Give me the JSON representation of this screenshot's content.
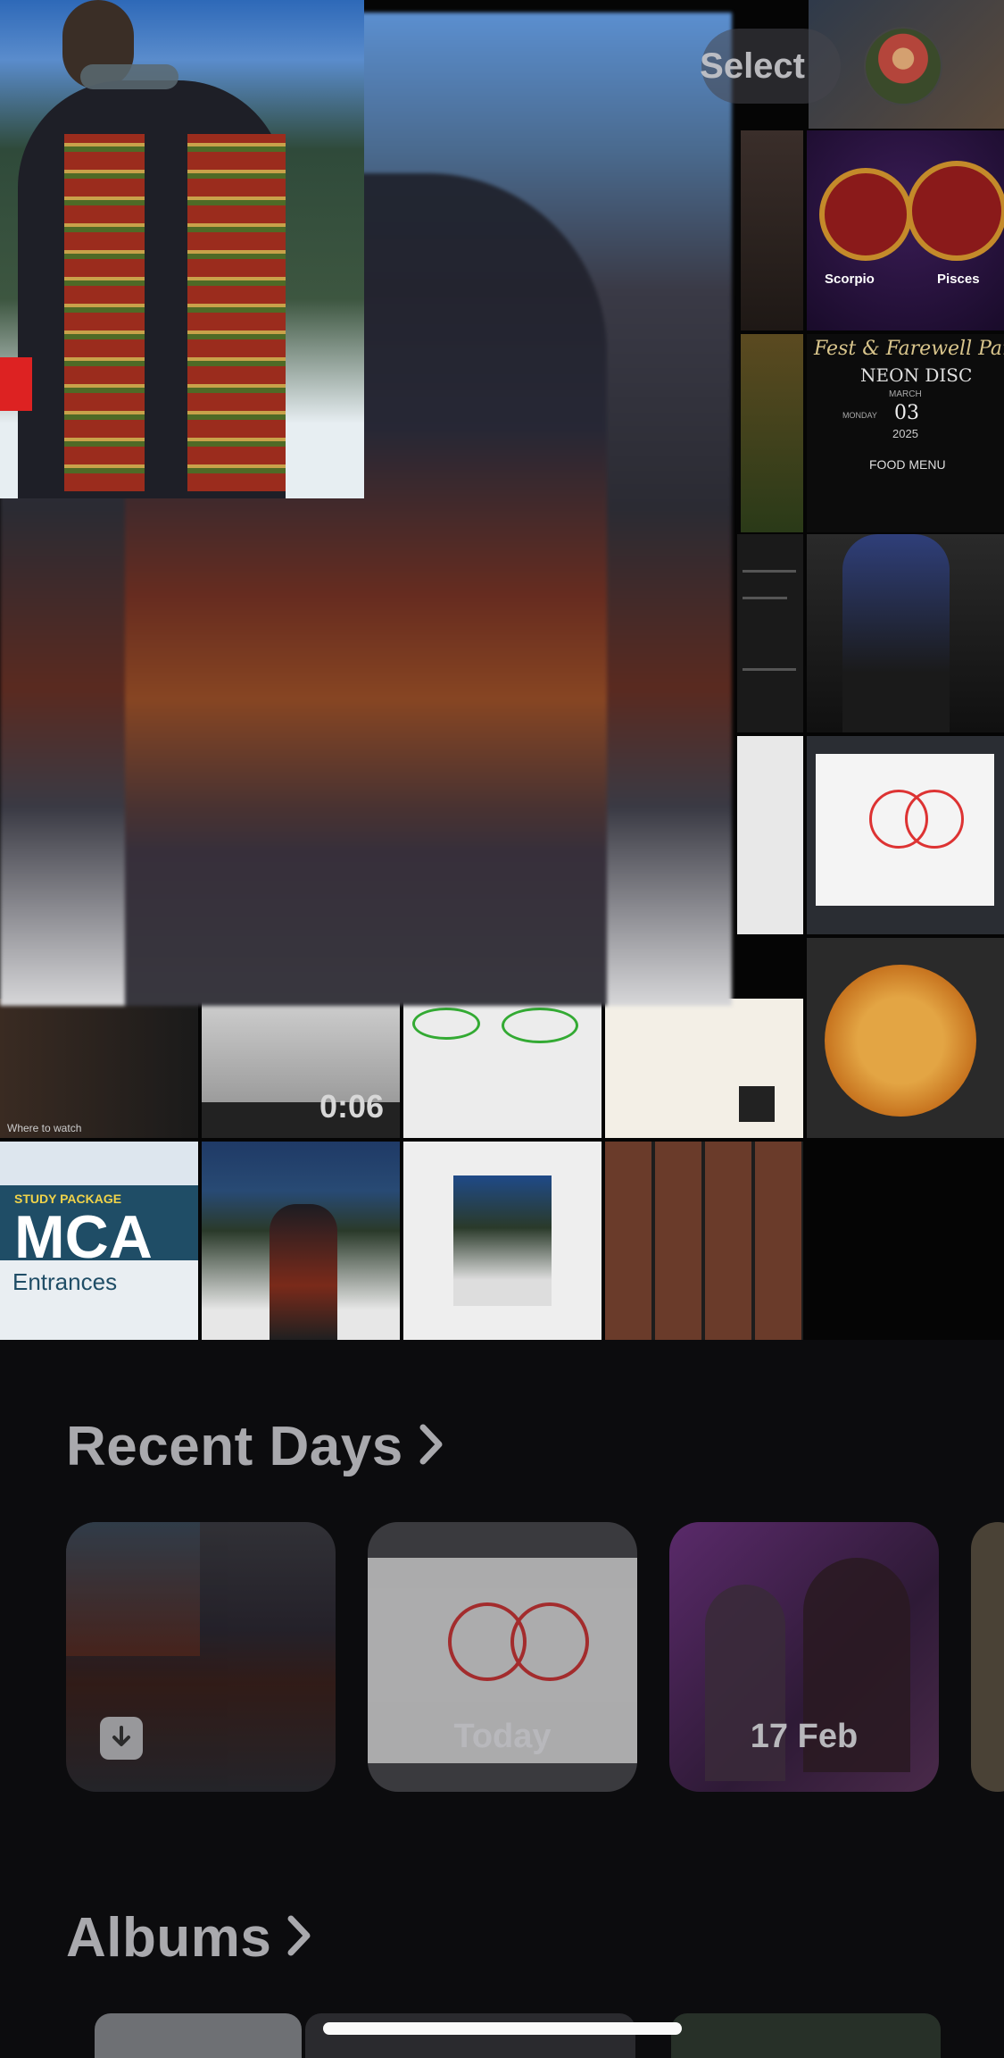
{
  "header": {
    "select_label": "Select",
    "avatar_alt": "profile-avatar"
  },
  "grid": {
    "tiles": [
      {
        "label": "Scorpio"
      },
      {
        "label": "Pisces"
      },
      {
        "label": "Fest & Farewell Party"
      },
      {
        "label": "NEON DISC"
      },
      {
        "label": "MARCH"
      },
      {
        "label": "MONDAY"
      },
      {
        "label": "03"
      },
      {
        "label": "2025"
      },
      {
        "label": "FOOD MENU"
      },
      {
        "label": "Where to watch"
      },
      {
        "label": "0:06"
      },
      {
        "label": "STUDY PACKAGE"
      },
      {
        "label": "MCA"
      },
      {
        "label": "Entrances"
      }
    ],
    "video_duration": "0:06"
  },
  "recent_days": {
    "title": "Recent Days",
    "cards": [
      {
        "label": ""
      },
      {
        "label": "Today"
      },
      {
        "label": "17 Feb"
      }
    ]
  },
  "albums": {
    "title": "Albums"
  },
  "colors": {
    "background": "#0c0c0e",
    "section_title": "#a9a9ad",
    "home_indicator": "#fafafa"
  }
}
